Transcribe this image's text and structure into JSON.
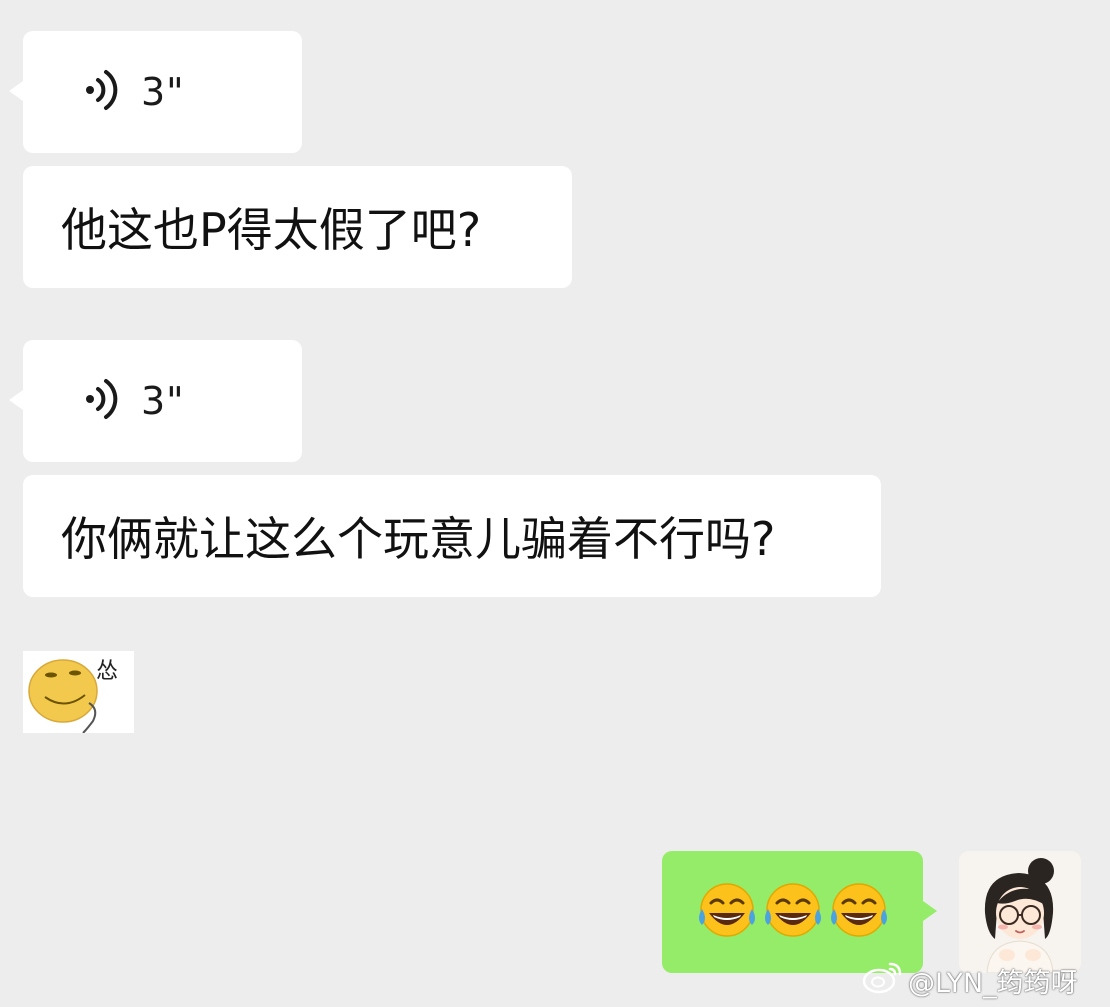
{
  "chat": {
    "messages": [
      {
        "type": "voice",
        "duration": "3\""
      },
      {
        "type": "text",
        "text": "他这也P得太假了吧?"
      },
      {
        "type": "voice",
        "duration": "3\""
      },
      {
        "type": "text",
        "text": "你俩就让这么个玩意儿骗着不行吗?"
      },
      {
        "type": "sticker",
        "caption": "怂",
        "icon": "sticker-smiley"
      },
      {
        "type": "outgoing",
        "emojis": [
          "😂",
          "😂",
          "😂"
        ]
      }
    ]
  },
  "watermark": {
    "text": "@LYN_筠筠呀",
    "icon": "weibo-logo-icon"
  },
  "colors": {
    "background": "#ededed",
    "incoming_bubble": "#ffffff",
    "outgoing_bubble": "#95ec69"
  }
}
